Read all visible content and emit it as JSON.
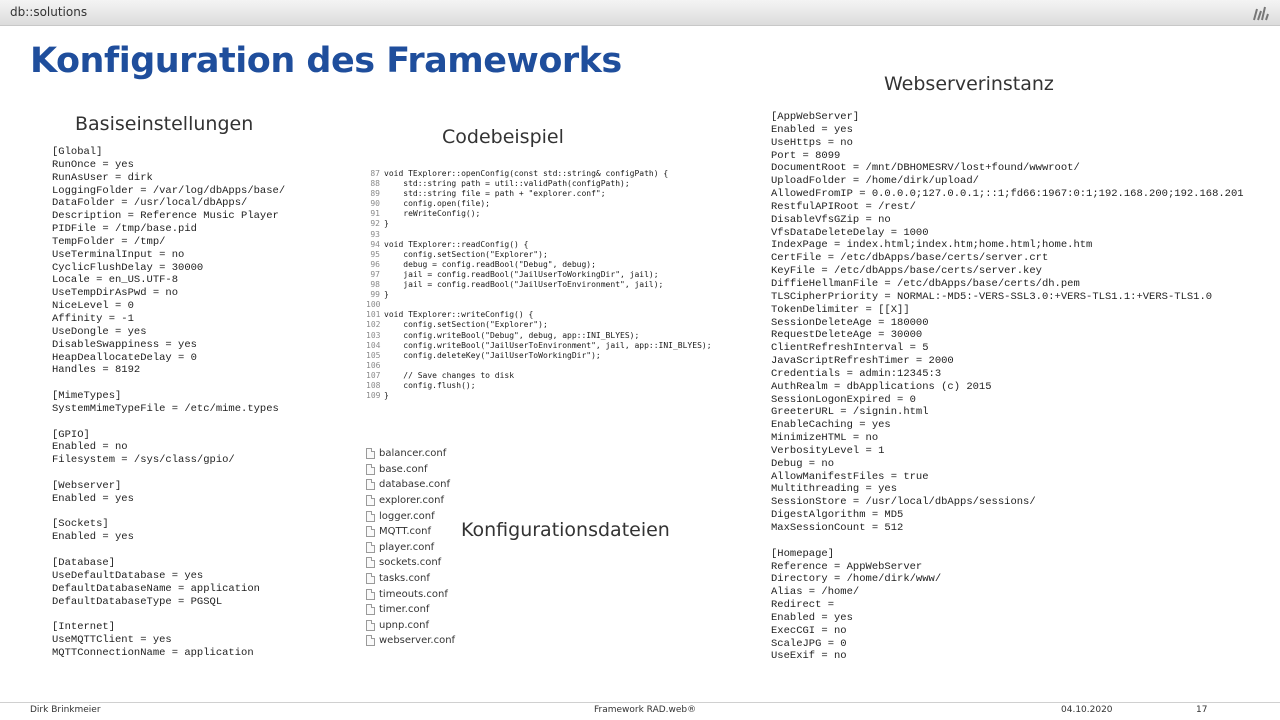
{
  "header": {
    "brand": "db::solutions"
  },
  "page_title": "Konfiguration des Frameworks",
  "headings": {
    "basis": "Basiseinstellungen",
    "code": "Codebeispiel",
    "web": "Webserverinstanz",
    "conf": "Konfigurationsdateien"
  },
  "basis_config": [
    "[Global]",
    "RunOnce = yes",
    "RunAsUser = dirk",
    "LoggingFolder = /var/log/dbApps/base/",
    "DataFolder = /usr/local/dbApps/",
    "Description = Reference Music Player",
    "PIDFile = /tmp/base.pid",
    "TempFolder = /tmp/",
    "UseTerminalInput = no",
    "CyclicFlushDelay = 30000",
    "Locale = en_US.UTF-8",
    "UseTempDirAsPwd = no",
    "NiceLevel = 0",
    "Affinity = -1",
    "UseDongle = yes",
    "DisableSwappiness = yes",
    "HeapDeallocateDelay = 0",
    "Handles = 8192",
    "",
    "[MimeTypes]",
    "SystemMimeTypeFile = /etc/mime.types",
    "",
    "[GPIO]",
    "Enabled = no",
    "Filesystem = /sys/class/gpio/",
    "",
    "[Webserver]",
    "Enabled = yes",
    "",
    "[Sockets]",
    "Enabled = yes",
    "",
    "[Database]",
    "UseDefaultDatabase = yes",
    "DefaultDatabaseName = application",
    "DefaultDatabaseType = PGSQL",
    "",
    "[Internet]",
    "UseMQTTClient = yes",
    "MQTTConnectionName = application"
  ],
  "web_config": [
    "[AppWebServer]",
    "Enabled = yes",
    "UseHttps = no",
    "Port = 8099",
    "DocumentRoot = /mnt/DBHOMESRV/lost+found/wwwroot/",
    "UploadFolder = /home/dirk/upload/",
    "AllowedFromIP = 0.0.0.0;127.0.0.1;::1;fd66:1967:0:1;192.168.200;192.168.201",
    "RestfulAPIRoot = /rest/",
    "DisableVfsGZip = no",
    "VfsDataDeleteDelay = 1000",
    "IndexPage = index.html;index.htm;home.html;home.htm",
    "CertFile = /etc/dbApps/base/certs/server.crt",
    "KeyFile = /etc/dbApps/base/certs/server.key",
    "DiffieHellmanFile = /etc/dbApps/base/certs/dh.pem",
    "TLSCipherPriority = NORMAL:-MD5:-VERS-SSL3.0:+VERS-TLS1.1:+VERS-TLS1.0",
    "TokenDelimiter = [[X]]",
    "SessionDeleteAge = 180000",
    "RequestDeleteAge = 30000",
    "ClientRefreshInterval = 5",
    "JavaScriptRefreshTimer = 2000",
    "Credentials = admin:12345:3",
    "AuthRealm = dbApplications (c) 2015",
    "SessionLogonExpired = 0",
    "GreeterURL = /signin.html",
    "EnableCaching = yes",
    "MinimizeHTML = no",
    "VerbosityLevel = 1",
    "Debug = no",
    "AllowManifestFiles = true",
    "Multithreading = yes",
    "SessionStore = /usr/local/dbApps/sessions/",
    "DigestAlgorithm = MD5",
    "MaxSessionCount = 512",
    "",
    "[Homepage]",
    "Reference = AppWebServer",
    "Directory = /home/dirk/www/",
    "Alias = /home/",
    "Redirect =",
    "Enabled = yes",
    "ExecCGI = no",
    "ScaleJPG = 0",
    "UseExif = no"
  ],
  "code_lines": [
    {
      "n": "87",
      "t": "void TExplorer::openConfig(const std::string& configPath) {"
    },
    {
      "n": "88",
      "t": "    std::string path = util::validPath(configPath);"
    },
    {
      "n": "89",
      "t": "    std::string file = path + \"explorer.conf\";"
    },
    {
      "n": "90",
      "t": "    config.open(file);"
    },
    {
      "n": "91",
      "t": "    reWriteConfig();"
    },
    {
      "n": "92",
      "t": "}"
    },
    {
      "n": "93",
      "t": ""
    },
    {
      "n": "94",
      "t": "void TExplorer::readConfig() {"
    },
    {
      "n": "95",
      "t": "    config.setSection(\"Explorer\");"
    },
    {
      "n": "96",
      "t": "    debug = config.readBool(\"Debug\", debug);"
    },
    {
      "n": "97",
      "t": "    jail = config.readBool(\"JailUserToWorkingDir\", jail);"
    },
    {
      "n": "98",
      "t": "    jail = config.readBool(\"JailUserToEnvironment\", jail);"
    },
    {
      "n": "99",
      "t": "}"
    },
    {
      "n": "100",
      "t": ""
    },
    {
      "n": "101",
      "t": "void TExplorer::writeConfig() {"
    },
    {
      "n": "102",
      "t": "    config.setSection(\"Explorer\");"
    },
    {
      "n": "103",
      "t": "    config.writeBool(\"Debug\", debug, app::INI_BLYES);"
    },
    {
      "n": "104",
      "t": "    config.writeBool(\"JailUserToEnvironment\", jail, app::INI_BLYES);"
    },
    {
      "n": "105",
      "t": "    config.deleteKey(\"JailUserToWorkingDir\");"
    },
    {
      "n": "106",
      "t": ""
    },
    {
      "n": "107",
      "t": "    // Save changes to disk"
    },
    {
      "n": "108",
      "t": "    config.flush();"
    },
    {
      "n": "109",
      "t": "}"
    }
  ],
  "files": [
    "balancer.conf",
    "base.conf",
    "database.conf",
    "explorer.conf",
    "logger.conf",
    "MQTT.conf",
    "player.conf",
    "sockets.conf",
    "tasks.conf",
    "timeouts.conf",
    "timer.conf",
    "upnp.conf",
    "webserver.conf"
  ],
  "footer": {
    "author": "Dirk Brinkmeier",
    "center": "Framework RAD.web®",
    "date": "04.10.2020",
    "page": "17"
  }
}
